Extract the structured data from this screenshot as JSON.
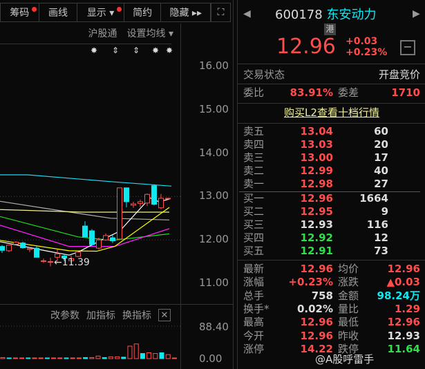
{
  "toolbar": {
    "items": [
      {
        "label": "筹码",
        "dot": true
      },
      {
        "label": "画线",
        "dot": false
      },
      {
        "label": "显示 ▾",
        "dot": true
      },
      {
        "label": "简约",
        "dot": false
      },
      {
        "label": "隐藏 ▸▸",
        "dot": false
      }
    ],
    "fullscreen_icon": "⛶"
  },
  "chart_header": {
    "hk_connect": "沪股通",
    "ma_setting": "设置均线 ▾"
  },
  "price_axis": [
    "16.00",
    "15.00",
    "14.00",
    "13.00",
    "12.00",
    "11.00"
  ],
  "low_marker": "←11.39",
  "volume": {
    "buttons": [
      "改参数",
      "加指标",
      "换指标"
    ],
    "close": "✕",
    "axis": [
      "88.40",
      "0.00"
    ]
  },
  "colors": {
    "up": "#ff5050",
    "down": "#10e8f0"
  },
  "chart_data": {
    "type": "candlestick",
    "ylim": [
      11,
      16
    ],
    "candles": [
      [
        11.85,
        11.88,
        11.7,
        11.76
      ],
      [
        11.75,
        11.88,
        11.72,
        11.88
      ],
      [
        11.9,
        11.97,
        11.88,
        11.95
      ],
      [
        11.93,
        11.96,
        11.8,
        11.82
      ],
      [
        11.78,
        11.84,
        11.72,
        11.8
      ],
      [
        11.81,
        11.85,
        11.6,
        11.6
      ],
      [
        11.52,
        11.57,
        11.47,
        11.52
      ],
      [
        11.49,
        11.59,
        11.39,
        11.5
      ],
      [
        11.6,
        11.78,
        11.5,
        11.68
      ],
      [
        11.63,
        11.67,
        11.51,
        11.58
      ],
      [
        11.52,
        11.64,
        11.48,
        11.57
      ],
      [
        11.62,
        11.74,
        11.6,
        11.72
      ],
      [
        12.32,
        12.43,
        12.07,
        12.07
      ],
      [
        12.21,
        12.25,
        11.86,
        11.89
      ],
      [
        11.81,
        12.05,
        11.78,
        12.0
      ],
      [
        12.0,
        12.15,
        11.98,
        12.1
      ],
      [
        12.05,
        12.11,
        11.93,
        11.98
      ],
      [
        12.02,
        13.2,
        12.02,
        13.2
      ],
      [
        13.2,
        13.2,
        12.75,
        12.88
      ],
      [
        12.8,
        12.88,
        12.74,
        12.83
      ],
      [
        12.84,
        12.93,
        12.76,
        12.88
      ],
      [
        12.85,
        13.07,
        12.78,
        13.05
      ],
      [
        13.25,
        13.28,
        12.8,
        12.82
      ],
      [
        12.74,
        13.06,
        12.71,
        12.96
      ],
      [
        12.96,
        12.96,
        12.96,
        12.96
      ]
    ],
    "volumes": [
      3,
      2,
      2,
      2,
      2,
      2,
      2,
      2,
      2,
      2,
      2,
      2,
      2,
      3,
      3,
      7,
      3,
      5,
      5,
      4,
      34,
      40,
      14,
      16,
      14,
      16,
      11,
      1
    ],
    "ma": [
      {
        "color": "#20d8f0",
        "pts": [
          [
            -0.3,
            13.5
          ],
          [
            3.7,
            13.5
          ],
          [
            16,
            13.34
          ],
          [
            24.5,
            13.24
          ]
        ]
      },
      {
        "color": "#b0b0b0",
        "pts": [
          [
            -0.3,
            12.89
          ],
          [
            9,
            12.66
          ],
          [
            15.7,
            12.5
          ],
          [
            24.2,
            12.46
          ]
        ]
      },
      {
        "color": "#f0f090",
        "pts": [
          [
            -0.3,
            12.7
          ],
          [
            11.7,
            12.64
          ],
          [
            24.2,
            12.64
          ]
        ]
      },
      {
        "color": "#20e020",
        "pts": [
          [
            -0.3,
            12.54
          ],
          [
            11,
            12.07
          ],
          [
            16,
            11.99
          ],
          [
            24.2,
            12.14
          ]
        ]
      },
      {
        "color": "#ff20ff",
        "pts": [
          [
            -0.3,
            12.34
          ],
          [
            9.7,
            11.85
          ],
          [
            16.3,
            11.85
          ],
          [
            24.2,
            12.26
          ]
        ]
      },
      {
        "color": "#ffff00",
        "pts": [
          [
            -0.3,
            11.99
          ],
          [
            9.7,
            11.75
          ],
          [
            13.7,
            11.74
          ],
          [
            16.3,
            11.85
          ],
          [
            24.2,
            12.75
          ]
        ]
      },
      {
        "color": "#ffffff",
        "pts": [
          [
            -0.3,
            11.96
          ],
          [
            6.3,
            11.75
          ],
          [
            9.7,
            11.65
          ],
          [
            11,
            11.72
          ],
          [
            14.3,
            11.99
          ],
          [
            17,
            12.2
          ],
          [
            21.4,
            12.97
          ],
          [
            22.7,
            12.88
          ],
          [
            24.2,
            12.94
          ]
        ]
      }
    ]
  },
  "quote": {
    "code": "600178",
    "name": "东安动力",
    "badge": "港",
    "price": "12.96",
    "change": "+0.03",
    "change_pct": "+0.23%",
    "status_label": "交易状态",
    "status": "开盘竞价",
    "ratio_label": "委比",
    "ratio": "83.91%",
    "diff_label": "委差",
    "diff": "1710",
    "l2": "购买L2查看十档行情",
    "asks": [
      {
        "l": "卖五",
        "p": "13.04",
        "v": "60",
        "c": "red"
      },
      {
        "l": "卖四",
        "p": "13.03",
        "v": "20",
        "c": "red"
      },
      {
        "l": "卖三",
        "p": "13.00",
        "v": "17",
        "c": "red"
      },
      {
        "l": "卖二",
        "p": "12.99",
        "v": "40",
        "c": "red"
      },
      {
        "l": "卖一",
        "p": "12.98",
        "v": "27",
        "c": "red"
      }
    ],
    "bids": [
      {
        "l": "买一",
        "p": "12.96",
        "v": "1664",
        "c": "red"
      },
      {
        "l": "买二",
        "p": "12.95",
        "v": "9",
        "c": "red"
      },
      {
        "l": "买三",
        "p": "12.93",
        "v": "116",
        "c": "wht"
      },
      {
        "l": "买四",
        "p": "12.92",
        "v": "12",
        "c": "grn"
      },
      {
        "l": "买五",
        "p": "12.91",
        "v": "73",
        "c": "grn"
      }
    ],
    "stats": [
      [
        "最新",
        "12.96",
        "red",
        "均价",
        "12.96",
        "red"
      ],
      [
        "涨幅",
        "+0.23%",
        "red",
        "涨跌",
        "▲0.03",
        "red"
      ],
      [
        "总手",
        "758",
        "wht",
        "金额",
        "98.24万",
        "cy"
      ],
      [
        "换手*",
        "0.02%",
        "wht",
        "量比",
        "1.29",
        "red"
      ],
      [
        "最高",
        "12.96",
        "red",
        "最低",
        "12.96",
        "red"
      ],
      [
        "今开",
        "12.96",
        "red",
        "昨收",
        "12.93",
        "wht"
      ],
      [
        "涨停",
        "14.22",
        "red",
        "跌停",
        "11.64",
        "grn"
      ]
    ]
  },
  "watermark": "@A股呼雷手"
}
